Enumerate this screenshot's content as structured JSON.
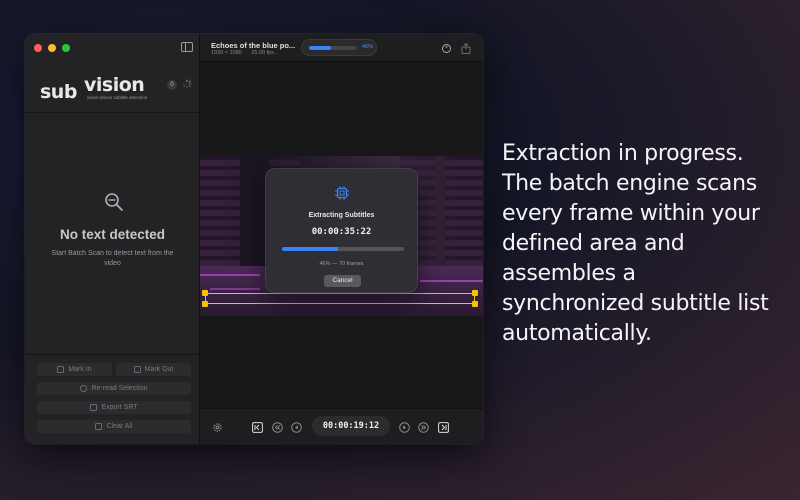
{
  "app": {
    "logo_sub": "sub",
    "logo_vision": "vision",
    "tagline": "vision-driven subtitle detection",
    "detected_count": "0"
  },
  "sidebar": {
    "empty_title": "No text detected",
    "empty_subtitle": "Start Batch Scan to detect text from the video",
    "mark_in": "Mark In",
    "mark_out": "Mark Out",
    "reread": "Re-read Selection",
    "export": "Export SRT",
    "clear": "Clear All"
  },
  "titlebar": {
    "file_name": "Echoes of the blue po...",
    "resolution": "1920 × 1080",
    "fps": "25.00 fps...",
    "progress_percent": 46,
    "progress_label": "46%"
  },
  "modal": {
    "title": "Extracting Subtitles",
    "timecode": "00:00:35:22",
    "progress_percent": 46,
    "caption": "46%  —  70 frames",
    "cancel_label": "Cancel"
  },
  "player": {
    "timecode": "00:00:19:12"
  },
  "headline": "Extraction in progress. The batch engine scans every frame within your defined area and assembles a synchronized subtitle list automatically.",
  "colors": {
    "accent": "#3b82f6",
    "selection": "#f5c400",
    "close": "#fe5f57",
    "minimize": "#febc2e",
    "zoom": "#28c840"
  }
}
